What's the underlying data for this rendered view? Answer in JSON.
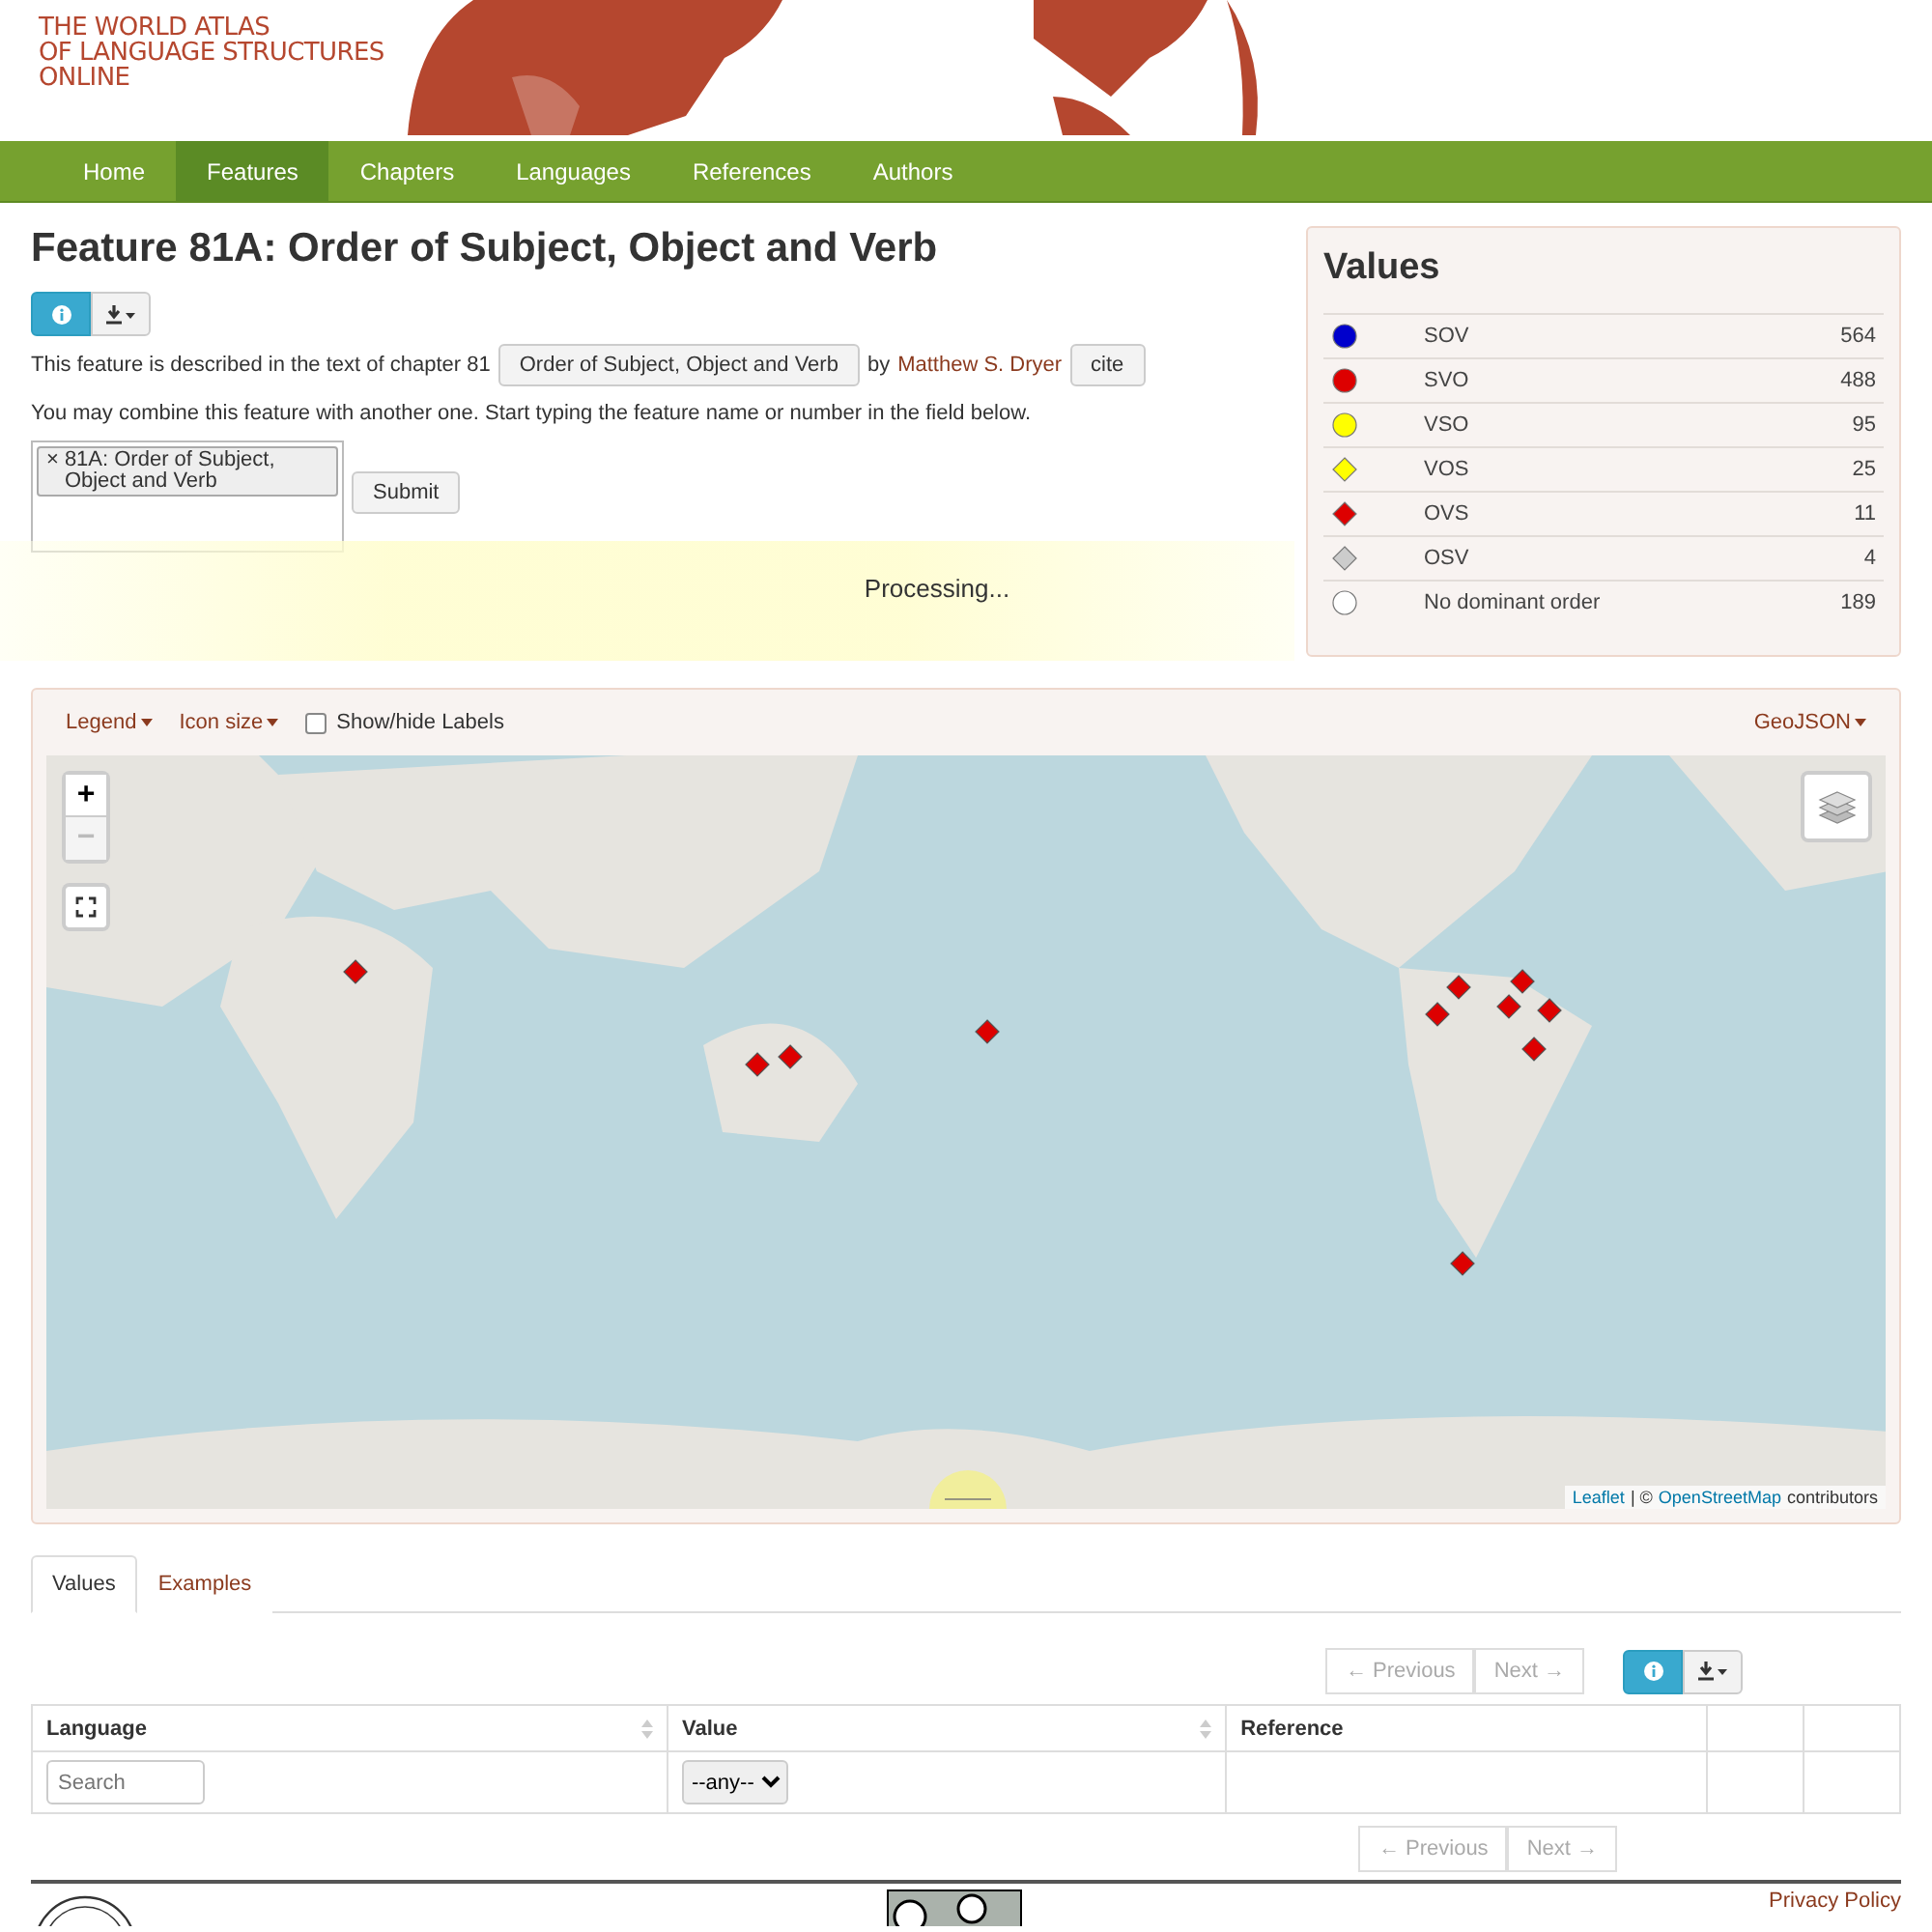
{
  "header": {
    "logo_lines": [
      "THE WORLD ATLAS",
      "OF LANGUAGE STRUCTURES",
      "ONLINE"
    ]
  },
  "nav": [
    {
      "label": "Home",
      "selected": false
    },
    {
      "label": "Features",
      "selected": true
    },
    {
      "label": "Chapters",
      "selected": false
    },
    {
      "label": "Languages",
      "selected": false
    },
    {
      "label": "References",
      "selected": false
    },
    {
      "label": "Authors",
      "selected": false
    }
  ],
  "feature": {
    "title": "Feature 81A: Order of Subject, Object and Verb",
    "description_prefix": "This feature is described in the text of chapter 81",
    "chapter_button": "Order of Subject, Object and Verb",
    "by": "by",
    "author": "Matthew S. Dryer",
    "cite_button": "cite",
    "combine_text": "You may combine this feature with another one. Start typing the feature name or number in the field below.",
    "selected_tag": "81A: Order of Subject, Object and Verb",
    "tag_remove": "×",
    "submit": "Submit"
  },
  "processing": "Processing...",
  "values_panel": {
    "title": "Values",
    "items": [
      {
        "kind": "circle",
        "color": "#0000cc",
        "label": "SOV",
        "count": "564"
      },
      {
        "kind": "circle",
        "color": "#dd0000",
        "label": "SVO",
        "count": "488"
      },
      {
        "kind": "circle",
        "color": "#ffff00",
        "label": "VSO",
        "count": "95"
      },
      {
        "kind": "diamond",
        "color": "#ffff00",
        "label": "VOS",
        "count": "25"
      },
      {
        "kind": "diamond",
        "color": "#dd0000",
        "label": "OVS",
        "count": "11"
      },
      {
        "kind": "diamond",
        "color": "#cccccc",
        "label": "OSV",
        "count": "4"
      },
      {
        "kind": "circle",
        "color": "#ffffff",
        "label": "No dominant order",
        "count": "189"
      }
    ]
  },
  "map": {
    "toolbar": {
      "legend": "Legend",
      "icon_size": "Icon size",
      "labels_checkbox": {
        "label": "Show/hide Labels",
        "checked": false
      },
      "geojson": "GeoJSON"
    },
    "zoom_in": "+",
    "zoom_out": "−",
    "attribution": {
      "leaflet": "Leaflet",
      "separator": "| ©",
      "osm": "OpenStreetMap",
      "suffix": "contributors"
    }
  },
  "tabs": [
    {
      "label": "Values",
      "selected": true
    },
    {
      "label": "Examples",
      "selected": false
    }
  ],
  "pager": {
    "previous": "← Previous",
    "next": "Next →"
  },
  "bottom_pager": {
    "previous": "← Previous",
    "next": "Next →"
  },
  "table": {
    "columns": [
      {
        "label": "Language",
        "sortable": true
      },
      {
        "label": "Value",
        "sortable": true
      },
      {
        "label": "Reference",
        "sortable": false
      }
    ],
    "search_placeholder": "Search",
    "value_filter": "--any--"
  },
  "footer": {
    "privacy": "Privacy Policy"
  }
}
